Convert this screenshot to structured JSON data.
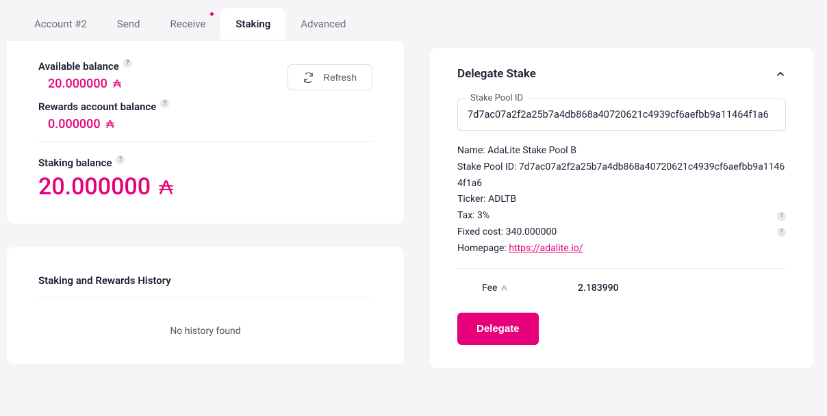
{
  "tabs": {
    "account": "Account #2",
    "send": "Send",
    "receive": "Receive",
    "staking": "Staking",
    "advanced": "Advanced"
  },
  "balances": {
    "available_label": "Available balance",
    "available_value": "20.000000",
    "rewards_label": "Rewards account balance",
    "rewards_value": "0.000000",
    "staking_label": "Staking balance",
    "staking_value": "20.000000",
    "refresh_label": "Refresh"
  },
  "history": {
    "title": "Staking and Rewards History",
    "empty": "No history found"
  },
  "delegate": {
    "title": "Delegate Stake",
    "pool_id_label": "Stake Pool ID",
    "pool_id_value": "7d7ac07a2f2a25b7a4db868a40720621c4939cf6aefbb9a11464f1a6",
    "name_label": "Name: ",
    "name_value": "AdaLite Stake Pool B",
    "stakepool_label": "Stake Pool ID: ",
    "stakepool_value": "7d7ac07a2f2a25b7a4db868a40720621c4939cf6aefbb9a11464f1a6",
    "ticker_label": "Ticker: ",
    "ticker_value": "ADLTB",
    "tax_label": "Tax: ",
    "tax_value": "3%",
    "fixedcost_label": "Fixed cost: ",
    "fixedcost_value": "340.000000",
    "homepage_label": "Homepage: ",
    "homepage_value": "https://adalite.io/",
    "fee_label": "Fee",
    "fee_value": "2.183990",
    "button": "Delegate"
  },
  "symbols": {
    "currency": "₳",
    "help": "?"
  }
}
